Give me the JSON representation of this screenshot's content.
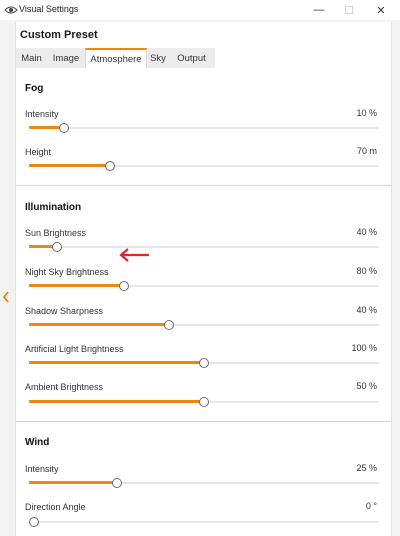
{
  "window": {
    "title": "Visual Settings",
    "icon": "eye-icon",
    "controls": {
      "minimize": "—",
      "maximize": "☐",
      "close": "✕"
    }
  },
  "preset_title": "Custom Preset",
  "tabs": [
    {
      "label": "Main",
      "active": false
    },
    {
      "label": "Image",
      "active": false
    },
    {
      "label": "Atmosphere",
      "active": true
    },
    {
      "label": "Sky",
      "active": false
    },
    {
      "label": "Output",
      "active": false
    }
  ],
  "accent_color": "#f0860e",
  "sections": [
    {
      "title": "Fog",
      "rows": [
        {
          "label": "Intensity",
          "value": "10",
          "unit": "%",
          "value_text": "10 %",
          "level": 0.1
        },
        {
          "label": "Height",
          "value": "70",
          "unit": "m",
          "value_text": "70 m",
          "level": 0.23
        }
      ]
    },
    {
      "title": "Illumination",
      "rows": [
        {
          "label": "Sun Brightness",
          "value": "40",
          "unit": "%",
          "value_text": "40 %",
          "level": 0.08
        },
        {
          "label": "Night Sky Brightness",
          "value": "80",
          "unit": "%",
          "value_text": "80 %",
          "level": 0.27
        },
        {
          "label": "Shadow Sharpness",
          "value": "40",
          "unit": "%",
          "value_text": "40 %",
          "level": 0.4
        },
        {
          "label": "Artificial Light Brightness",
          "value": "100",
          "unit": "%",
          "value_text": "100 %",
          "level": 0.5
        },
        {
          "label": "Ambient Brightness",
          "value": "50",
          "unit": "%",
          "value_text": "50 %",
          "level": 0.5
        }
      ]
    },
    {
      "title": "Wind",
      "rows": [
        {
          "label": "Intensity",
          "value": "25",
          "unit": "%",
          "value_text": "25 %",
          "level": 0.25
        },
        {
          "label": "Direction Angle",
          "value": "0",
          "unit": "°",
          "value_text": "0 °",
          "level": 0.0
        }
      ]
    }
  ],
  "annotation": {
    "icon": "red-arrow-left-icon",
    "target": "Sun Brightness",
    "color": "#e0262a"
  },
  "collapse_icon": "chevron-left-icon"
}
